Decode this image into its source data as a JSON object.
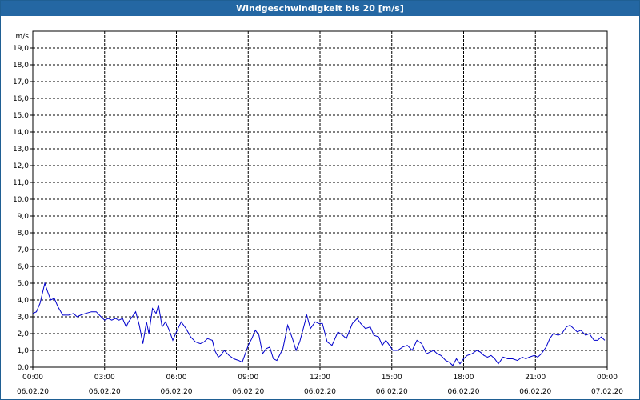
{
  "window": {
    "title": "Windgeschwindigkeit bis 20 [m/s]"
  },
  "chart_data": {
    "type": "line",
    "title": "Windgeschwindigkeit bis 20 [m/s]",
    "ylabel": "m/s",
    "ylim": [
      0,
      20
    ],
    "y_ticks": [
      "0,0",
      "1,0",
      "2,0",
      "3,0",
      "4,0",
      "5,0",
      "6,0",
      "7,0",
      "8,0",
      "9,0",
      "10,0",
      "11,0",
      "12,0",
      "13,0",
      "14,0",
      "15,0",
      "16,0",
      "17,0",
      "18,0",
      "19,0"
    ],
    "x_range_hours": [
      0,
      24
    ],
    "x_ticks": [
      {
        "time": "00:00",
        "date": "06.02.20"
      },
      {
        "time": "03:00",
        "date": "06.02.20"
      },
      {
        "time": "06:00",
        "date": "06.02.20"
      },
      {
        "time": "09:00",
        "date": "06.02.20"
      },
      {
        "time": "12:00",
        "date": "06.02.20"
      },
      {
        "time": "15:00",
        "date": "06.02.20"
      },
      {
        "time": "18:00",
        "date": "06.02.20"
      },
      {
        "time": "21:00",
        "date": "06.02.20"
      },
      {
        "time": "00:00",
        "date": "07.02.20"
      }
    ],
    "grid": true,
    "line_color": "#0000cc",
    "series": [
      {
        "x_hours": [
          0.0,
          0.15,
          0.3,
          0.5,
          0.62,
          0.75,
          0.9,
          1.05,
          1.25,
          1.5,
          1.7,
          1.85,
          2.0,
          2.2,
          2.45,
          2.65,
          2.85,
          3.0,
          3.15,
          3.3,
          3.45,
          3.6,
          3.75,
          3.9,
          4.0,
          4.15,
          4.3,
          4.45,
          4.6,
          4.75,
          4.85,
          5.0,
          5.15,
          5.25,
          5.4,
          5.55,
          5.7,
          5.85,
          6.0,
          6.2,
          6.4,
          6.6,
          6.8,
          7.0,
          7.15,
          7.3,
          7.5,
          7.6,
          7.75,
          7.85,
          8.0,
          8.2,
          8.4,
          8.6,
          8.75,
          9.0,
          9.15,
          9.3,
          9.45,
          9.6,
          9.75,
          9.9,
          10.05,
          10.2,
          10.45,
          10.65,
          10.85,
          11.0,
          11.15,
          11.3,
          11.45,
          11.6,
          11.8,
          11.95,
          12.1,
          12.3,
          12.5,
          12.75,
          12.95,
          13.1,
          13.35,
          13.55,
          13.7,
          13.9,
          14.1,
          14.25,
          14.45,
          14.6,
          14.75,
          14.9,
          15.05,
          15.25,
          15.45,
          15.65,
          15.85,
          16.05,
          16.25,
          16.45,
          16.6,
          16.75,
          16.9,
          17.05,
          17.25,
          17.4,
          17.55,
          17.7,
          17.85,
          18.0,
          18.15,
          18.35,
          18.55,
          18.7,
          18.85,
          19.0,
          19.15,
          19.3,
          19.45,
          19.65,
          19.85,
          20.05,
          20.25,
          20.45,
          20.6,
          20.75,
          20.95,
          21.1,
          21.25,
          21.45,
          21.6,
          21.75,
          21.95,
          22.1,
          22.3,
          22.45,
          22.6,
          22.75,
          22.9,
          23.1,
          23.25,
          23.45,
          23.6,
          23.75,
          23.9
        ],
        "values": [
          3.2,
          3.3,
          3.8,
          5.0,
          4.5,
          4.0,
          4.1,
          3.6,
          3.1,
          3.1,
          3.2,
          3.0,
          3.1,
          3.2,
          3.3,
          3.3,
          3.0,
          2.8,
          2.9,
          2.8,
          2.9,
          2.8,
          2.9,
          2.4,
          2.7,
          3.0,
          3.3,
          2.5,
          1.4,
          2.7,
          2.0,
          3.5,
          3.2,
          3.7,
          2.4,
          2.7,
          2.2,
          1.6,
          2.1,
          2.7,
          2.3,
          1.8,
          1.5,
          1.4,
          1.5,
          1.7,
          1.6,
          1.0,
          0.6,
          0.7,
          1.0,
          0.7,
          0.5,
          0.4,
          0.3,
          1.3,
          1.7,
          2.2,
          1.9,
          0.8,
          1.1,
          1.2,
          0.5,
          0.4,
          1.1,
          2.5,
          1.7,
          1.0,
          1.5,
          2.3,
          3.1,
          2.3,
          2.7,
          2.6,
          2.6,
          1.5,
          1.3,
          2.1,
          1.9,
          1.7,
          2.6,
          2.9,
          2.6,
          2.3,
          2.4,
          1.9,
          1.8,
          1.3,
          1.6,
          1.3,
          1.0,
          1.0,
          1.2,
          1.3,
          1.0,
          1.6,
          1.4,
          0.8,
          0.9,
          1.0,
          0.8,
          0.7,
          0.4,
          0.3,
          0.1,
          0.5,
          0.2,
          0.5,
          0.7,
          0.8,
          1.0,
          0.9,
          0.7,
          0.6,
          0.7,
          0.5,
          0.2,
          0.6,
          0.5,
          0.5,
          0.4,
          0.6,
          0.5,
          0.6,
          0.7,
          0.6,
          0.8,
          1.2,
          1.7,
          2.0,
          1.9,
          2.0,
          2.4,
          2.5,
          2.3,
          2.1,
          2.2,
          1.9,
          2.0,
          1.6,
          1.6,
          1.8,
          1.6
        ]
      }
    ]
  }
}
